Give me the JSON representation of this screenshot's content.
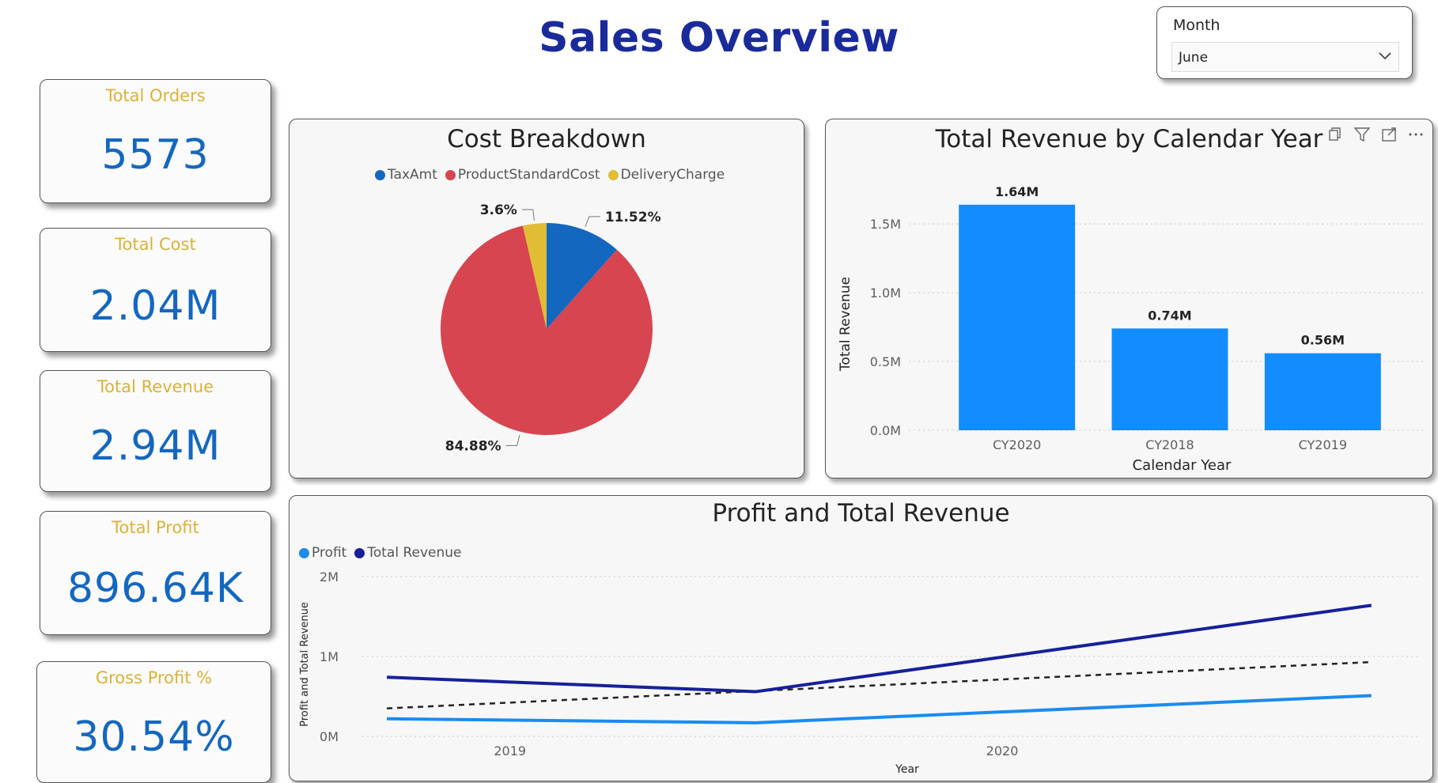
{
  "header": {
    "title": "Sales Overview"
  },
  "slicer": {
    "label": "Month",
    "value": "June"
  },
  "cards": [
    {
      "label": "Total Orders",
      "value": "5573"
    },
    {
      "label": "Total Cost",
      "value": "2.04M"
    },
    {
      "label": "Total Revenue",
      "value": "2.94M"
    },
    {
      "label": "Total Profit",
      "value": "896.64K"
    },
    {
      "label": "Gross Profit %",
      "value": "30.54%"
    }
  ],
  "colors": {
    "title": "#1b2a9b",
    "card_label": "#d9b238",
    "card_value": "#1467bf",
    "tax": "#1467bf",
    "cost": "#d64550",
    "delivery": "#e0bd35",
    "bar": "#128cff",
    "profit_line": "#1a8cf0",
    "revenue_line": "#17209a"
  },
  "chart_data": [
    {
      "type": "pie",
      "title": "Cost Breakdown",
      "series": [
        {
          "name": "TaxAmt",
          "value": 11.52,
          "label": "11.52%",
          "color": "#1467bf"
        },
        {
          "name": "ProductStandardCost",
          "value": 84.88,
          "label": "84.88%",
          "color": "#d64550"
        },
        {
          "name": "DeliveryCharge",
          "value": 3.6,
          "label": "3.6%",
          "color": "#e0bd35"
        }
      ],
      "legend": "top"
    },
    {
      "type": "bar",
      "title": "Total Revenue by Calendar Year",
      "categories": [
        "CY2020",
        "CY2018",
        "CY2019"
      ],
      "values": [
        1.64,
        0.74,
        0.56
      ],
      "data_labels": [
        "1.64M",
        "0.74M",
        "0.56M"
      ],
      "xlabel": "Calendar Year",
      "ylabel": "Total Revenue",
      "ylim": [
        0,
        1.8
      ],
      "yticks": [
        0,
        0.5,
        1.0,
        1.5
      ],
      "ytick_labels": [
        "0.0M",
        "0.5M",
        "1.0M",
        "1.5M"
      ],
      "grid": true,
      "header_icons": [
        "copy-icon",
        "filter-icon",
        "focus-mode-icon",
        "more-options-icon"
      ]
    },
    {
      "type": "line",
      "title": "Profit and Total Revenue",
      "xlabel": "Year",
      "ylabel": "Profit and Total Revenue",
      "x": [
        2018.75,
        2019.5,
        2020.75
      ],
      "xticks": [
        2019,
        2020
      ],
      "xtick_labels": [
        "2019",
        "2020"
      ],
      "xlim": [
        2018.7,
        2020.85
      ],
      "ylim": [
        0,
        2
      ],
      "yticks": [
        0,
        1,
        2
      ],
      "ytick_labels": [
        "0M",
        "1M",
        "2M"
      ],
      "series": [
        {
          "name": "Profit",
          "values": [
            0.22,
            0.17,
            0.51
          ],
          "color": "#1a8cf0"
        },
        {
          "name": "Total Revenue",
          "values": [
            0.74,
            0.56,
            1.64
          ],
          "color": "#17209a"
        }
      ],
      "trend_line": {
        "values": [
          0.35,
          0.93
        ],
        "style": "dashed"
      },
      "legend": "top-left"
    }
  ]
}
